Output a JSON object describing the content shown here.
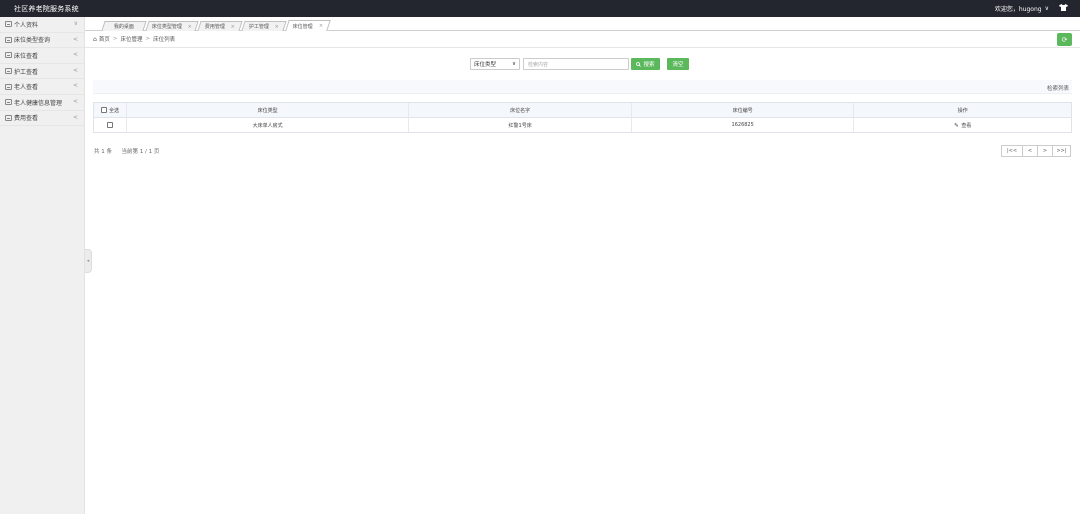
{
  "app": {
    "title": "社区养老院服务系统"
  },
  "user": {
    "welcome": "欢迎您，hugong",
    "caret": "∨",
    "shirt_icon": "shirt-icon"
  },
  "sidebar": {
    "items": [
      {
        "label": "个人资料",
        "arrow": "∨"
      },
      {
        "label": "床位类型查询",
        "arrow": "<"
      },
      {
        "label": "床位查看",
        "arrow": "<"
      },
      {
        "label": "护工查看",
        "arrow": "<"
      },
      {
        "label": "老人查看",
        "arrow": "<"
      },
      {
        "label": "老人健康信息管理",
        "arrow": "<"
      },
      {
        "label": "费用查看",
        "arrow": "<"
      }
    ],
    "collapse_glyph": "◂"
  },
  "tabs": [
    {
      "label": "我的桌面",
      "close": ""
    },
    {
      "label": "床位类型管理",
      "close": "×"
    },
    {
      "label": "费用管理",
      "close": "×"
    },
    {
      "label": "护工管理",
      "close": "×"
    },
    {
      "label": "床位管理",
      "close": "×"
    }
  ],
  "breadcrumb": {
    "home_glyph": "⌂",
    "home": "首页",
    "sep": ">",
    "level1": "床位管理",
    "level2": "床位列表"
  },
  "refresh_glyph": "⟳",
  "search": {
    "select_value": "床位类型",
    "select_caret": "∨",
    "placeholder": "检索内容",
    "search_glyph": "🔍",
    "search_label": "搜索",
    "clear_label": "清空"
  },
  "result_label": "检索列表",
  "table": {
    "select_all": "全选",
    "columns": [
      "床位类型",
      "床位名字",
      "床位编号",
      "操作"
    ],
    "rows": [
      {
        "type": "大床单人房式",
        "name": "红警1号床",
        "number": "1626825",
        "action_glyph": "✎",
        "action": "查看"
      }
    ]
  },
  "pager": {
    "total": "共 1 条",
    "current": "当前第 1 / 1 页",
    "first": "|<<",
    "prev": "<",
    "next": ">",
    "last": ">>|"
  },
  "colors": {
    "topbar": "#23262e",
    "accent_green": "#5cb85c",
    "sidebar_bg": "#f0f0f0"
  }
}
